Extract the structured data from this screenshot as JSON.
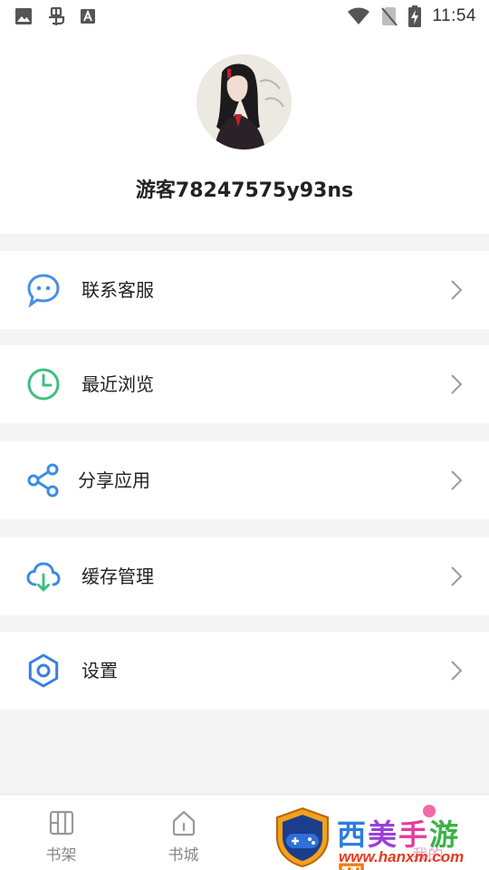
{
  "status_bar": {
    "time": "11:54",
    "icons": [
      "image-icon",
      "bug-icon",
      "font-icon",
      "wifi-icon",
      "no-sim-icon",
      "battery-charging-icon"
    ]
  },
  "profile": {
    "username": "游客78247575y93ns"
  },
  "menu": {
    "items": [
      {
        "label": "联系客服",
        "icon": "chat-bubble-icon",
        "color": "#4a90e2"
      },
      {
        "label": "最近浏览",
        "icon": "clock-icon",
        "color": "#3fbf7f"
      },
      {
        "label": "分享应用",
        "icon": "share-icon",
        "color": "#3a8de0"
      },
      {
        "label": "缓存管理",
        "icon": "cloud-download-icon",
        "color": "#3fbf7f"
      },
      {
        "label": "设置",
        "icon": "gear-icon",
        "color": "#3a7fe0"
      }
    ]
  },
  "tabbar": {
    "tabs": [
      {
        "label": "书架",
        "icon": "bookshelf-icon"
      },
      {
        "label": "书城",
        "icon": "home-icon"
      },
      {
        "label": "",
        "icon": ""
      },
      {
        "label": "我的",
        "icon": "profile-icon"
      }
    ],
    "active_color": "#e8a6c8",
    "inactive_color": "#888888"
  },
  "watermark": {
    "title": "西美手游网",
    "url": "www.hanxm.com"
  }
}
